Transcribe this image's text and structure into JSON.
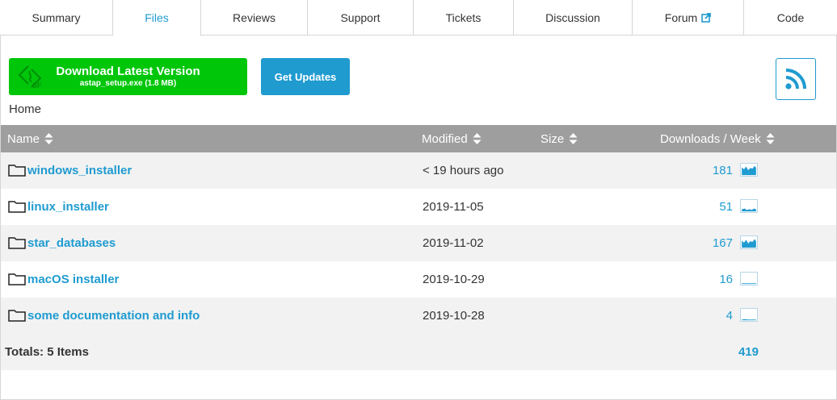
{
  "tabs": [
    {
      "label": "Summary"
    },
    {
      "label": "Files",
      "active": true
    },
    {
      "label": "Reviews"
    },
    {
      "label": "Support"
    },
    {
      "label": "Tickets"
    },
    {
      "label": "Discussion"
    },
    {
      "label": "Forum"
    },
    {
      "label": "Code"
    }
  ],
  "download": {
    "title": "Download Latest Version",
    "file": "astap_setup.exe (1.8 MB)"
  },
  "updates_label": "Get Updates",
  "breadcrumb": "Home",
  "table": {
    "headers": {
      "name": "Name",
      "modified": "Modified",
      "size": "Size",
      "downloads": "Downloads / Week"
    },
    "rows": [
      {
        "name": "windows_installer",
        "modified": "< 19 hours ago",
        "downloads": "181",
        "activity": "high"
      },
      {
        "name": "linux_installer",
        "modified": "2019-11-05",
        "downloads": "51",
        "activity": "low"
      },
      {
        "name": "star_databases",
        "modified": "2019-11-02",
        "downloads": "167",
        "activity": "high"
      },
      {
        "name": "macOS installer",
        "modified": "2019-10-29",
        "downloads": "16",
        "activity": "minimal"
      },
      {
        "name": "some documentation and info",
        "modified": "2019-10-28",
        "downloads": "4",
        "activity": "minimal"
      }
    ],
    "totals_label": "Totals: 5 Items",
    "totals_count": "419"
  },
  "colors": {
    "accent": "#1f9bd0",
    "download_green": "#00c60a",
    "header_gray": "#9e9e9e",
    "row_alt": "#f2f2f2"
  },
  "icons": [
    "external-link-icon",
    "sourceforge-logo-icon",
    "rss-icon",
    "sort-icon",
    "folder-icon",
    "sparkline-icon"
  ]
}
